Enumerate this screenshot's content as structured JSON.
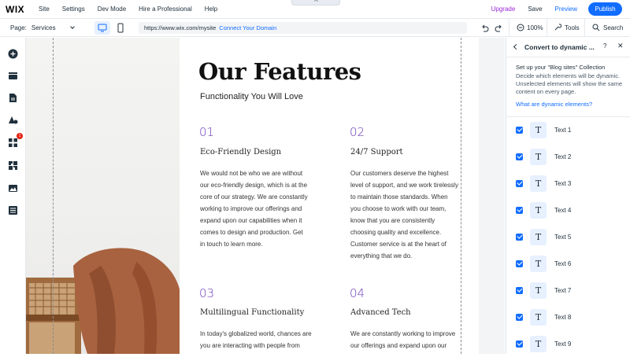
{
  "topbar": {
    "logo": "WIX",
    "menu": [
      "Site",
      "Settings",
      "Dev Mode",
      "Hire a Professional",
      "Help"
    ],
    "upgrade": "Upgrade",
    "save": "Save",
    "preview": "Preview",
    "publish": "Publish"
  },
  "toolbar": {
    "page_label": "Page:",
    "page_value": "Services",
    "url": "https://www.wix.com/mysite",
    "connect_domain": "Connect Your Domain",
    "zoom": "100%",
    "tools": "Tools",
    "search": "Search"
  },
  "left_toolbar": {
    "badge": "1"
  },
  "canvas": {
    "title": "Our Features",
    "subtitle": "Functionality You Will Love",
    "features": [
      {
        "num": "01",
        "heading": "Eco-Friendly Design",
        "lines": [
          "We would not be who we are without",
          "our eco-friendly design, which is at the",
          "core of our strategy. We are constantly",
          "working to improve our offerings and",
          "expand upon our capabilities when it",
          "comes to design and production. Get",
          "in touch to learn more."
        ]
      },
      {
        "num": "02",
        "heading": "24/7 Support",
        "lines": [
          "Our customers deserve the highest",
          "level of support, and we work tirelessly",
          "to maintain those standards. When",
          "you choose to work with our team,",
          "know that you are consistently",
          "choosing quality and excellence.",
          "Customer service is at the heart of",
          "everything that we do."
        ]
      },
      {
        "num": "03",
        "heading": "Multilingual Functionality",
        "lines": [
          "In today's globalized world, chances are",
          "you are interacting with people from"
        ]
      },
      {
        "num": "04",
        "heading": "Advanced Tech",
        "lines": [
          "We are constantly working to improve",
          "our offerings and expand upon our"
        ]
      }
    ]
  },
  "panel": {
    "title": "Convert to dynamic ...",
    "help": "?",
    "close": "✕",
    "lead": "Set up your \"Blog sites\" Collection",
    "desc": "Decide which elements will be dynamic. Unselected elements will show the same content on every page.",
    "link": "What are dynamic elements?",
    "items": [
      {
        "label": "Text 1",
        "icon": "T"
      },
      {
        "label": "Text 2",
        "icon": "T"
      },
      {
        "label": "Text 3",
        "icon": "T"
      },
      {
        "label": "Text 4",
        "icon": "T"
      },
      {
        "label": "Text 5",
        "icon": "T"
      },
      {
        "label": "Text 6",
        "icon": "T"
      },
      {
        "label": "Text 7",
        "icon": "T"
      },
      {
        "label": "Text 8",
        "icon": "T"
      },
      {
        "label": "Text 9",
        "icon": "T"
      }
    ]
  },
  "colors": {
    "accent": "#116dff",
    "upgrade": "#9a27d5",
    "feature_number": "#6a3cb8",
    "badge": "#e62214"
  }
}
